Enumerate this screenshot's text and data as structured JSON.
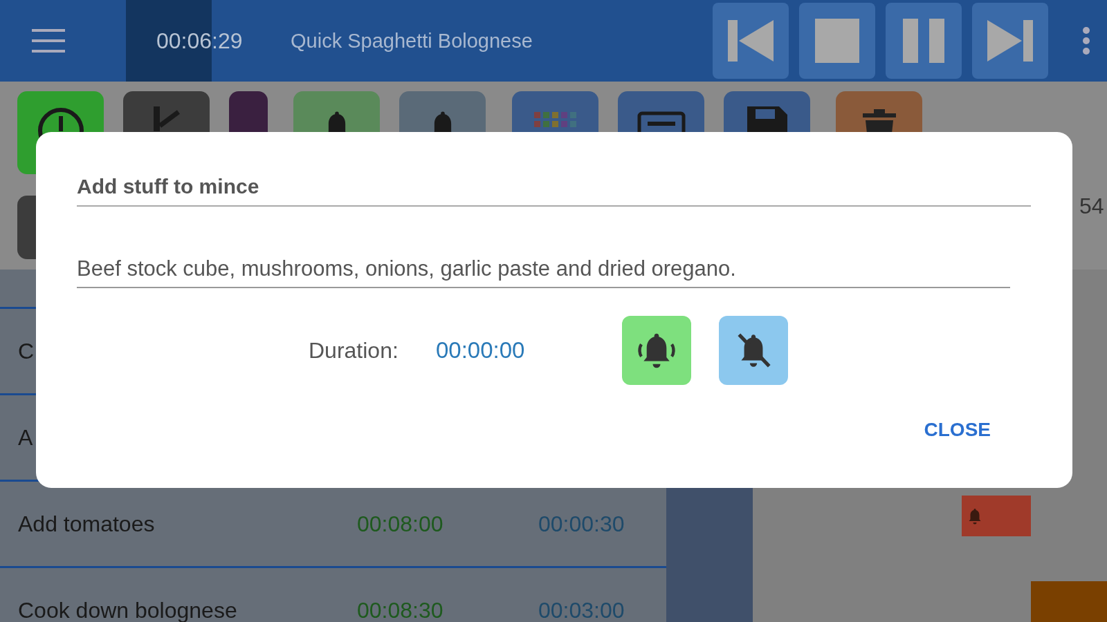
{
  "header": {
    "time": "00:06:29",
    "title": "Quick Spaghetti Bolognese",
    "transport": [
      {
        "kind": "previous"
      },
      {
        "kind": "stop"
      },
      {
        "kind": "pause"
      },
      {
        "kind": "next"
      }
    ]
  },
  "toolbar": [
    {
      "kind": "clock",
      "color": "#2f9e2f"
    },
    {
      "kind": "step",
      "color": "#3c3c3c"
    },
    {
      "kind": "blank",
      "color": "#3a2040"
    },
    {
      "kind": "bell",
      "color": "#5a8a5a"
    },
    {
      "kind": "bell",
      "color": "#5a6a78"
    },
    {
      "kind": "grid",
      "color": "#3a5a8a"
    },
    {
      "kind": "keyboard",
      "color": "#3a5a8a"
    },
    {
      "kind": "save",
      "color": "#3a5a8a"
    },
    {
      "kind": "trash",
      "color": "#8a5a3a"
    }
  ],
  "side_info": {
    "number": "54"
  },
  "steps": [
    {
      "name": "C"
    },
    {
      "name": "A"
    },
    {
      "name": "Add tomatoes",
      "start": "00:08:00",
      "duration": "00:00:30"
    },
    {
      "name": "Cook down bolognese",
      "start": "00:08:30",
      "duration": "00:03:00"
    }
  ],
  "markers": [
    {
      "kind": "alarm",
      "color": "#a03a2a"
    },
    {
      "kind": "plain",
      "color": "#7a4000"
    }
  ],
  "dialog": {
    "title": "Add stuff to mince",
    "description": "Beef stock cube, mushrooms, onions, garlic paste and dried oregano.",
    "duration_label": "Duration:",
    "duration": "00:00:00",
    "alert_buttons": [
      {
        "kind": "alarm-on"
      },
      {
        "kind": "alarm-off"
      }
    ],
    "close": "CLOSE"
  }
}
